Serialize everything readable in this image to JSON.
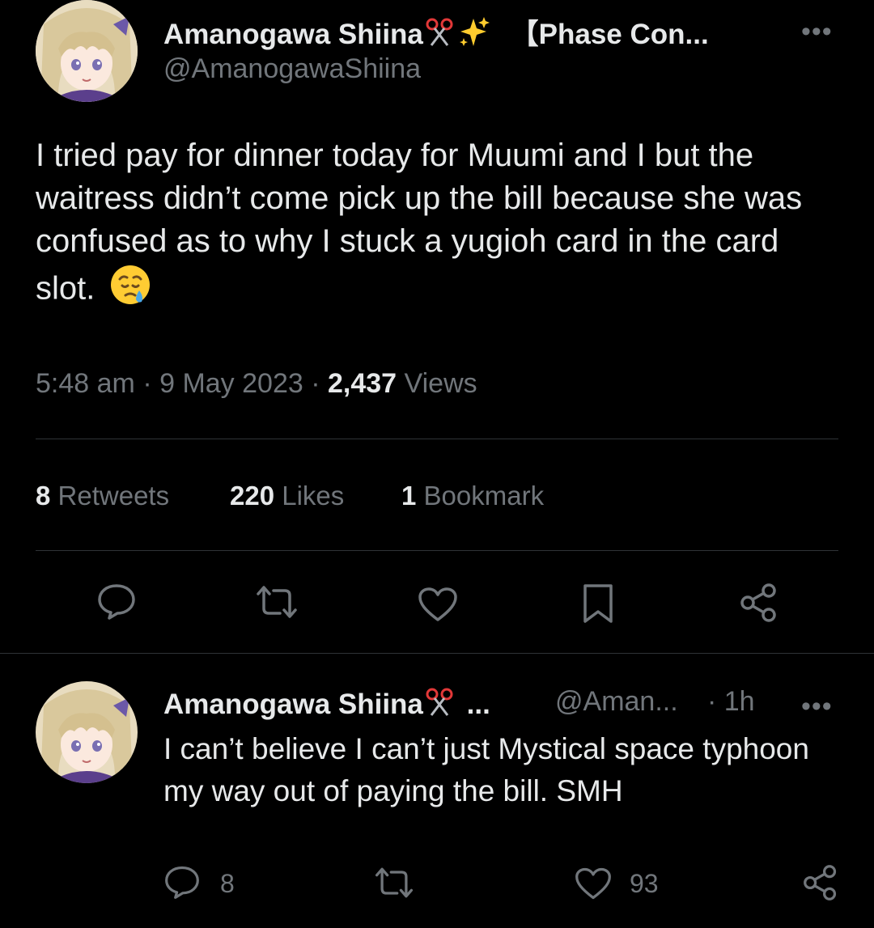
{
  "tweet": {
    "author": {
      "display_name": "Amanogawa Shiina",
      "name_suffix": "【Phase Con...",
      "handle": "@AmanogawaShiina",
      "badges": [
        "scissors-icon",
        "sparkles-icon"
      ]
    },
    "text": "I tried pay for dinner today for Muumi and I but the waitress didn’t come pick up the bill because she was confused as to why I stuck a yugioh card in the card slot.",
    "text_emoji": "crying-face-emoji",
    "time": "5:48 am",
    "date": "9 May 2023",
    "separator": "·",
    "views_count": "2,437",
    "views_label": "Views",
    "stats": {
      "retweets_count": "8",
      "retweets_label": "Retweets",
      "likes_count": "220",
      "likes_label": "Likes",
      "bookmarks_count": "1",
      "bookmarks_label": "Bookmark"
    },
    "more_label": "•••"
  },
  "reply": {
    "display_name": "Amanogawa Shiina",
    "name_ellipsis": "...",
    "handle": "@Aman...",
    "time": "· 1h",
    "text": "I can’t believe I can’t just Mystical space typhoon my way out of paying the bill. SMH",
    "reply_count": "8",
    "retweet_count": "",
    "like_count": "93",
    "more_label": "•••"
  },
  "colors": {
    "background": "#000000",
    "text_primary": "#e7e9ea",
    "text_secondary": "#71767b",
    "divider": "#2f3336"
  }
}
